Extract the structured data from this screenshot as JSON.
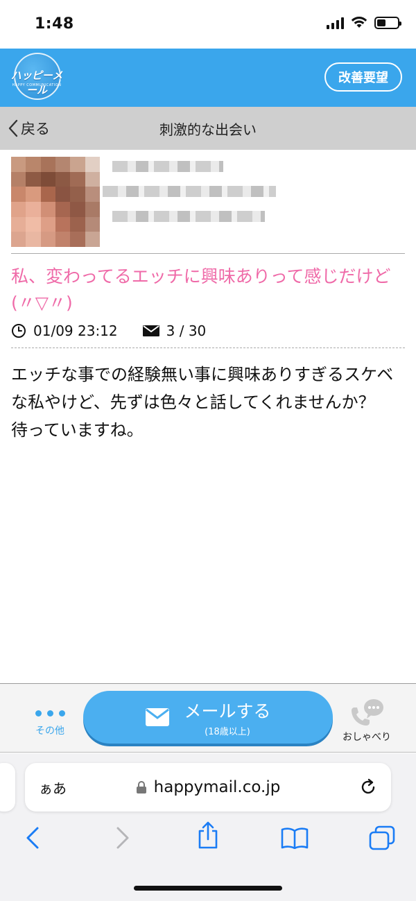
{
  "status_bar": {
    "time": "1:48"
  },
  "header": {
    "logo_text": "ハッピーメール",
    "logo_subtext": "HAPPY COMMUNICATION",
    "feedback_button": "改善要望"
  },
  "nav": {
    "back_label": "戻る",
    "title": "刺激的な出会い"
  },
  "post": {
    "title": "私、変わってるエッチに興味ありって感じだけど(〃▽〃)",
    "datetime": "01/09 23:12",
    "mail_count": "3 / 30",
    "body": "エッチな事での経験無い事に興味ありすぎるスケベな私やけど、先ずは色々と話してくれませんか？　待っていますね。"
  },
  "action_bar": {
    "other_label": "その他",
    "mail_button_label": "メールする",
    "mail_button_sub": "(18歳以上)",
    "chat_label": "おしゃべり"
  },
  "browser": {
    "text_size_label": "ぁあ",
    "url": "happymail.co.jp"
  },
  "colors": {
    "header_blue": "#3aa6ec",
    "title_pink": "#ef6aa8",
    "nav_gray": "#cfcfcf"
  }
}
